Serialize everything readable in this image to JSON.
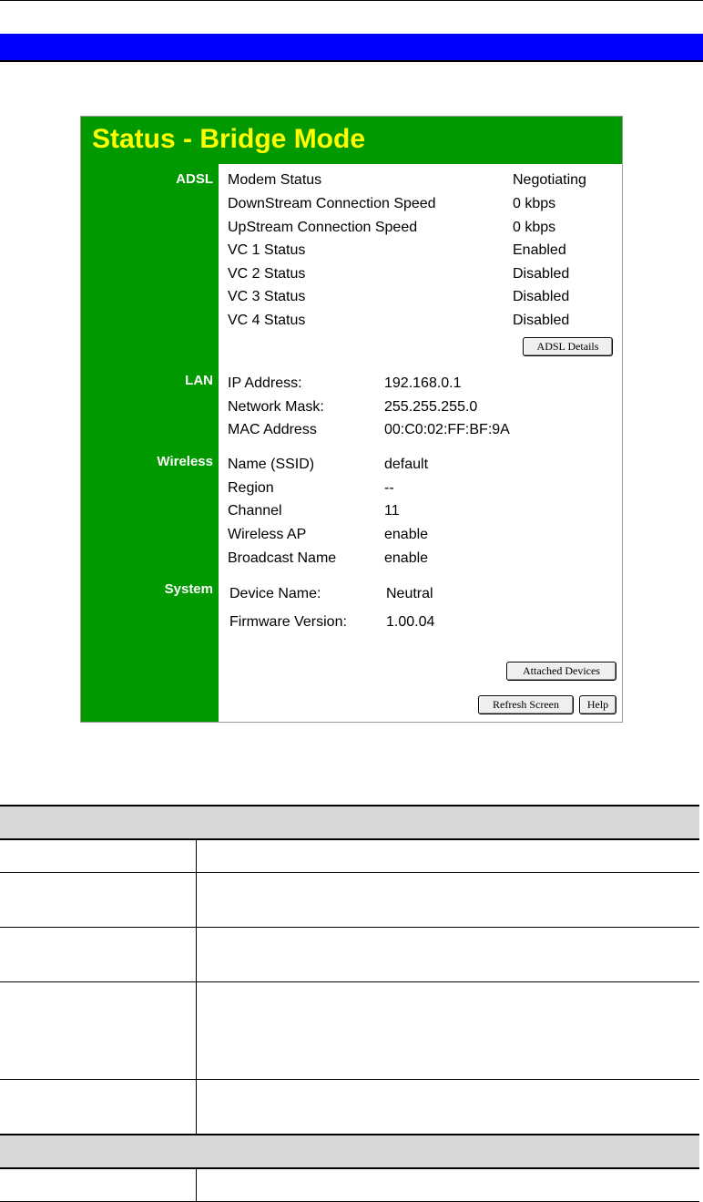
{
  "panel": {
    "title": "Status - Bridge Mode",
    "sections": {
      "adsl": "ADSL",
      "lan": "LAN",
      "wireless": "Wireless",
      "system": "System"
    },
    "adsl_rows": [
      {
        "label": "Modem Status",
        "value": "Negotiating"
      },
      {
        "label": "DownStream Connection Speed",
        "value": "0 kbps"
      },
      {
        "label": "UpStream Connection Speed",
        "value": "0 kbps"
      },
      {
        "label": "VC 1 Status",
        "value": "Enabled"
      },
      {
        "label": "VC 2 Status",
        "value": "Disabled"
      },
      {
        "label": "VC 3 Status",
        "value": "Disabled"
      },
      {
        "label": "VC 4 Status",
        "value": "Disabled"
      }
    ],
    "lan_rows": [
      {
        "label": "IP Address:",
        "value": "192.168.0.1"
      },
      {
        "label": "Network Mask:",
        "value": "255.255.255.0"
      },
      {
        "label": "MAC Address",
        "value": "00:C0:02:FF:BF:9A"
      }
    ],
    "wireless_rows": [
      {
        "label": "Name (SSID)",
        "value": "default"
      },
      {
        "label": "Region",
        "value": "--"
      },
      {
        "label": "Channel",
        "value": "11"
      },
      {
        "label": "Wireless AP",
        "value": "enable"
      },
      {
        "label": "Broadcast Name",
        "value": "enable"
      }
    ],
    "system_rows": [
      {
        "label": "Device Name:",
        "value": "Neutral"
      },
      {
        "label": "Firmware Version:",
        "value": "1.00.04"
      }
    ],
    "buttons": {
      "adsl_details": "ADSL Details",
      "attached_devices": "Attached Devices",
      "refresh_screen": "Refresh Screen",
      "help": "Help"
    }
  },
  "colors": {
    "panel_green": "#009900",
    "title_yellow": "#ffff00",
    "header_blue": "#0000ff",
    "table_header_gray": "#d8d8d8"
  }
}
